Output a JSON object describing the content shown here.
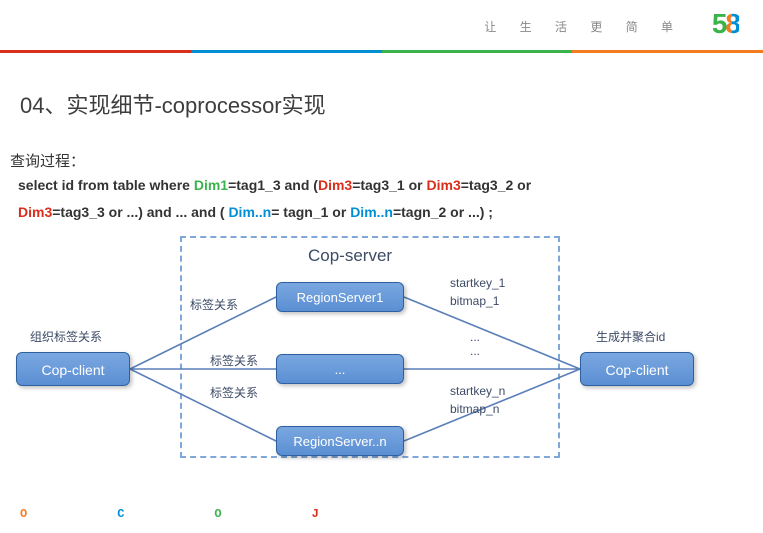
{
  "header": {
    "tagline": "让 生 活 更 简 单",
    "logo_5": "5",
    "logo_8": "8"
  },
  "title": "04、实现细节-coprocessor实现",
  "query_label": "查询过程：",
  "sql": {
    "pre1": "select id from table where ",
    "dim1": "Dim1",
    "eq1": "=tag1_3 and  (",
    "dim3a": "Dim3",
    "eq3a": "=tag3_1 or ",
    "dim3b": "Dim3",
    "eq3b": "=tag3_2 or",
    "dim3c": "Dim3",
    "eq3c": "=tag3_3 or ...) and  ... and ( ",
    "dimn1": "Dim..n",
    "eqn1": "= tagn_1 or ",
    "dimn2": "Dim..n",
    "eqn2": "=tagn_2 or ...) ;"
  },
  "diagram": {
    "cop_server": "Cop-server",
    "client_left": "Cop-client",
    "client_right": "Cop-client",
    "rs1": "RegionServer1",
    "rs2": "...",
    "rs3": "RegionServer..n",
    "left_label": "组织标签关系",
    "right_label": "生成并聚合id",
    "edge_label_1": "标签关系",
    "edge_label_2": "标签关系",
    "edge_label_3": "标签关系",
    "sk1": "startkey_1",
    "bm1": "bitmap_1",
    "mid_dots1": "...",
    "mid_dots2": "...",
    "skn": "startkey_n",
    "bmn": "bitmap_n"
  },
  "footer": {
    "i1": "O",
    "c1": "#f47b20",
    "i2": "C",
    "c2": "#008fd5",
    "i3": "O",
    "c3": "#3bb34b",
    "i4": "J",
    "c4": "#d92e1c"
  }
}
